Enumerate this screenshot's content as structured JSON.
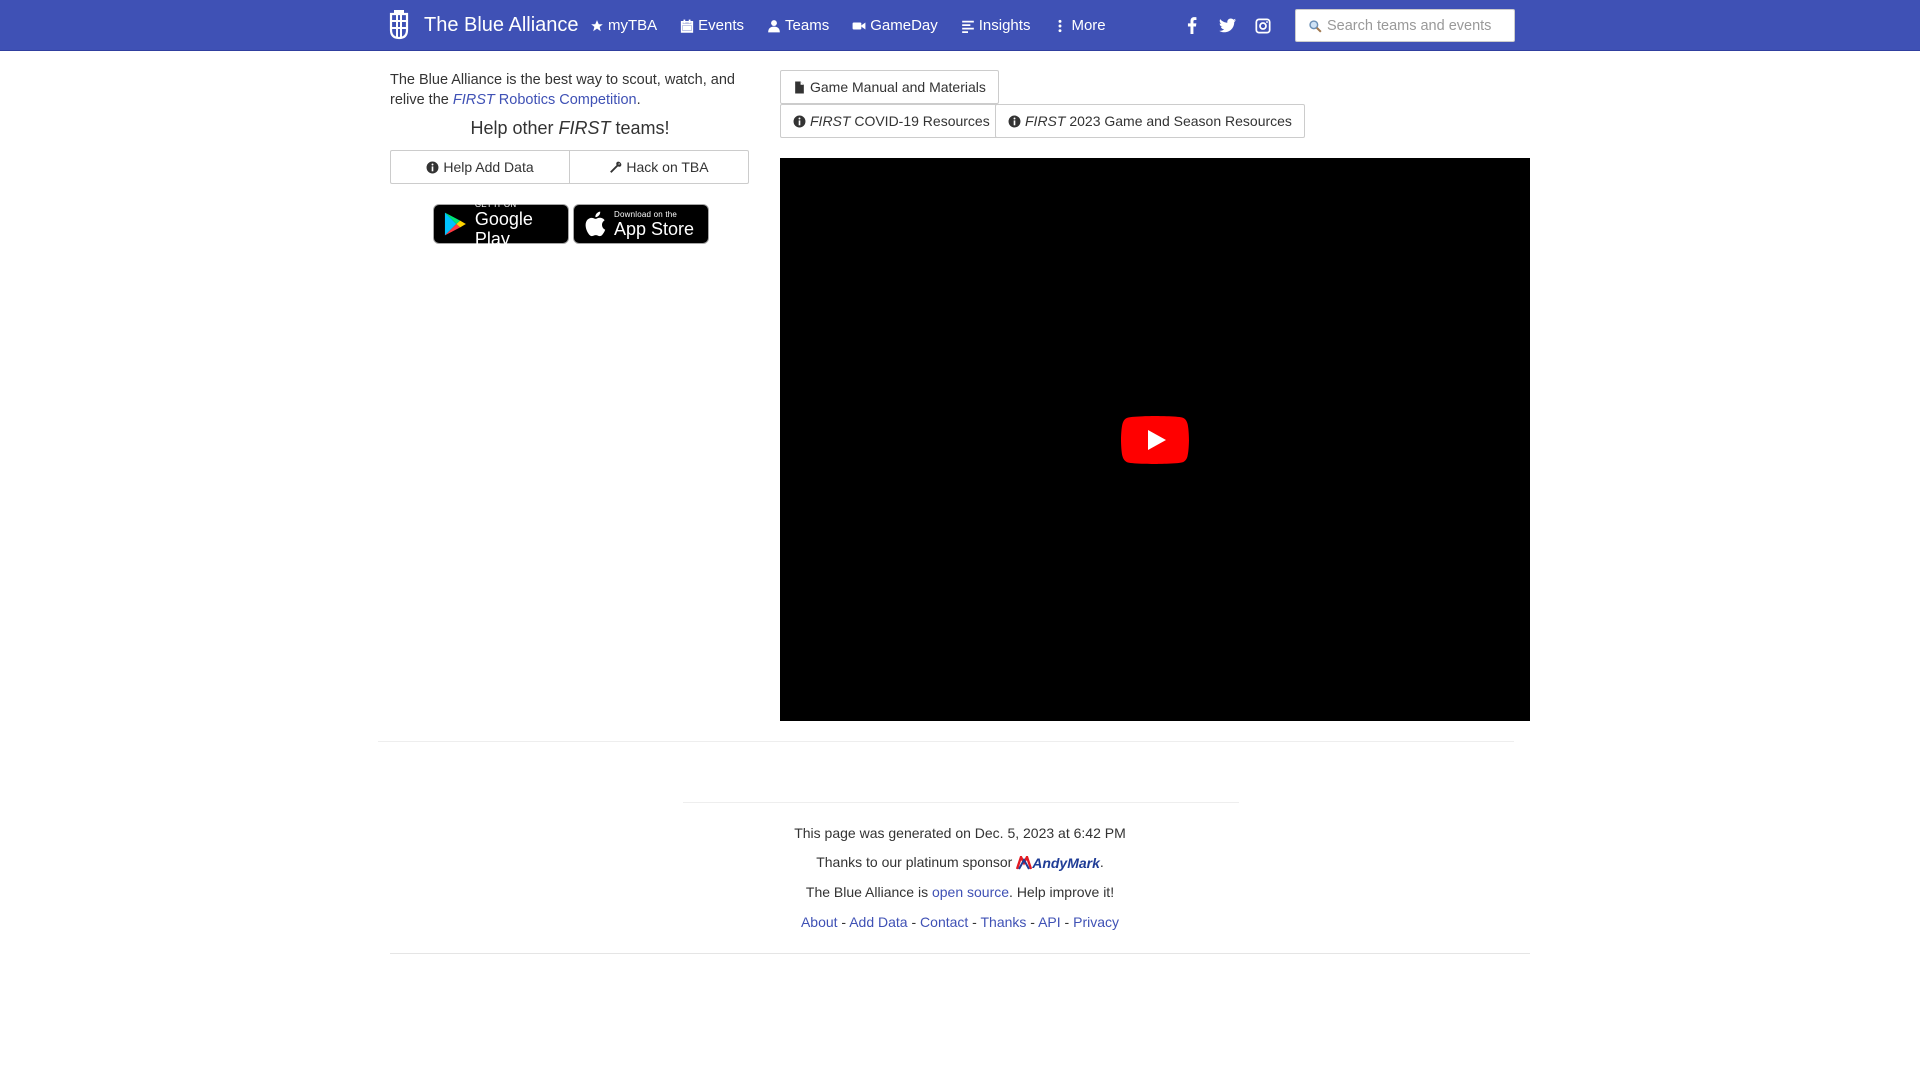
{
  "nav": {
    "brand": "The Blue Alliance",
    "links": [
      "myTBA",
      "Events",
      "Teams",
      "GameDay",
      "Insights",
      "More"
    ],
    "social": [
      "facebook-icon",
      "twitter-icon",
      "instagram-icon"
    ],
    "search_placeholder": "Search teams and events"
  },
  "intro": {
    "text_before": "The Blue Alliance is the best way to scout, watch, and relive the ",
    "first": "FIRST",
    "competition": " Robotics Competition",
    "period": "."
  },
  "help": {
    "before": "Help other ",
    "first": "FIRST",
    "after": " teams!",
    "add_data": "Help Add Data",
    "hack": "Hack on TBA"
  },
  "badges": {
    "google_small": "GET IT ON",
    "google_big": "Google Play",
    "apple_small": "Download on the",
    "apple_big": "App Store"
  },
  "resources": {
    "manual": "Game Manual and Materials",
    "covid_first": "FIRST",
    "covid_rest": " COVID-19 Resources",
    "season_first": "FIRST",
    "season_rest": " 2023 Game and Season Resources"
  },
  "footer": {
    "generated": "This page was generated on Dec. 5, 2023 at 6:42 PM",
    "sponsor_text": "Thanks to our platinum sponsor ",
    "sponsor_name": "AndyMark",
    "sponsor_period": ".",
    "oss_before": "The Blue Alliance is ",
    "oss_link": "open source",
    "oss_after": ". Help improve it!",
    "links": [
      "About",
      "Add Data",
      "Contact",
      "Thanks",
      "API",
      "Privacy"
    ],
    "separator": " - "
  },
  "colors": {
    "brand": "#3f51b5",
    "link": "#3f51b5",
    "andymark_red": "#e31b23",
    "andymark_blue": "#1f3c96"
  }
}
